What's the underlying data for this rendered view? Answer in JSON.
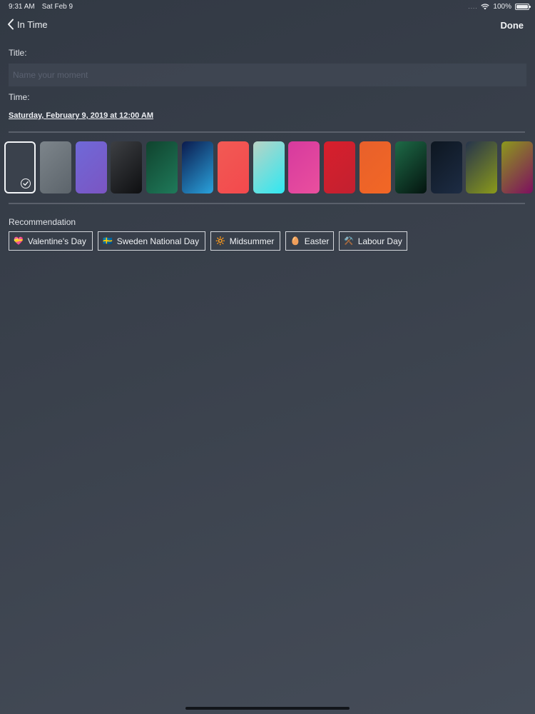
{
  "status_bar": {
    "time": "9:31 AM",
    "date": "Sat Feb 9",
    "dots": "....",
    "battery": "100%"
  },
  "nav": {
    "back_label": "In Time",
    "done_label": "Done"
  },
  "form": {
    "title_label": "Title:",
    "title_value": "",
    "title_placeholder": "Name your moment",
    "time_label": "Time:",
    "time_value": "Saturday, February 9, 2019 at 12:00 AM"
  },
  "swatches": [
    {
      "name": "slate",
      "gradient": [
        "#3a414c",
        "#3a414c"
      ],
      "selected": true
    },
    {
      "name": "gray",
      "gradient": [
        "#7d858b",
        "#5c646b"
      ],
      "selected": false
    },
    {
      "name": "purple",
      "gradient": [
        "#6f69d8",
        "#7b55c2"
      ],
      "selected": false
    },
    {
      "name": "black",
      "gradient": [
        "#3d3f43",
        "#0e0f11"
      ],
      "selected": false
    },
    {
      "name": "green",
      "gradient": [
        "#10432e",
        "#1f7a5a"
      ],
      "selected": false
    },
    {
      "name": "blue",
      "gradient": [
        "#0b1a4d",
        "#2aa3dd"
      ],
      "selected": false
    },
    {
      "name": "coral",
      "gradient": [
        "#f25a54",
        "#f3494d"
      ],
      "selected": false
    },
    {
      "name": "aqua",
      "gradient": [
        "#b9d3c5",
        "#2ee8f2"
      ],
      "selected": false
    },
    {
      "name": "pink",
      "gradient": [
        "#d63a9e",
        "#ea4f9e"
      ],
      "selected": false
    },
    {
      "name": "red",
      "gradient": [
        "#d81f2c",
        "#c22030"
      ],
      "selected": false
    },
    {
      "name": "orange",
      "gradient": [
        "#e8602b",
        "#f26725"
      ],
      "selected": false
    },
    {
      "name": "dark-green",
      "gradient": [
        "#1e6a47",
        "#04140f"
      ],
      "selected": false
    },
    {
      "name": "navy",
      "gradient": [
        "#0d1620",
        "#1d2c44"
      ],
      "selected": false
    },
    {
      "name": "olive",
      "gradient": [
        "#26344c",
        "#8b9a1a"
      ],
      "selected": false
    },
    {
      "name": "magenta-olive",
      "gradient": [
        "#8c9a1c",
        "#7e0e5f"
      ],
      "selected": false
    }
  ],
  "recommendation": {
    "label": "Recommendation",
    "chips": [
      {
        "emoji": "💝",
        "label": "Valentine's Day"
      },
      {
        "emoji": "🇸🇪",
        "label": "Sweden National Day"
      },
      {
        "emoji": "🔆",
        "label": "Midsummer"
      },
      {
        "emoji": "🥚",
        "label": "Easter"
      },
      {
        "emoji": "⚒️",
        "label": "Labour Day"
      }
    ]
  }
}
